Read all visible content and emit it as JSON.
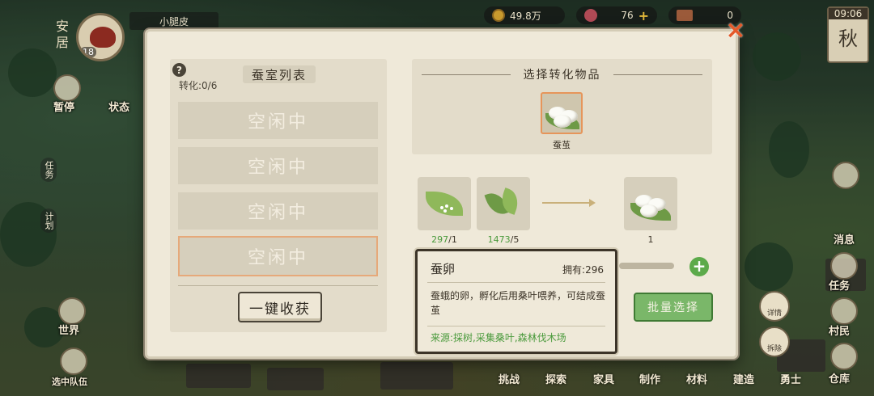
{
  "hud": {
    "home_label": "安居",
    "player_name": "小腿皮",
    "player_level": "18",
    "money": "49.8万",
    "gems": "76",
    "tickets": "0",
    "time": "09:06",
    "season": "秋"
  },
  "left_menu": [
    "暂停",
    "状态",
    "任务",
    "计划",
    "世界",
    "选中队伍"
  ],
  "right_menu": [
    "消息",
    "任务",
    "村民",
    "仓库"
  ],
  "bottom_nav": [
    "挑战",
    "探索",
    "家具",
    "制作",
    "材料",
    "建造",
    "勇士"
  ],
  "round_buttons": {
    "detail": "详情",
    "dismantle": "拆除"
  },
  "panel": {
    "help_icon": "?",
    "conversion_count": "转化:0/6",
    "list_title": "蚕室列表",
    "rooms": [
      "空闲中",
      "空闲中",
      "空闲中",
      "空闲中"
    ],
    "harvest_button": "一键收获",
    "select_title": "选择转化物品",
    "selected_item": "蚕茧",
    "recipe_inputs": [
      {
        "name": "蚕卵",
        "have": "297",
        "need": "/1"
      },
      {
        "name": "桑叶",
        "have": "1473",
        "need": "/5"
      }
    ],
    "recipe_output": {
      "name": "蚕茧",
      "qty": "1"
    },
    "batch_button": "批量选择",
    "plus_icon": "+",
    "close_icon": "×",
    "tooltip": {
      "name": "蚕卵",
      "owned": "拥有:296",
      "description": "蚕蛾的卵，孵化后用桑叶喂养，可结成蚕茧",
      "source": "来源:採树,采集桑叶,森林伐木场"
    }
  },
  "colors": {
    "accent_green": "#7ab769",
    "count_green": "#4a9a3c",
    "close_orange": "#e45a2a"
  }
}
